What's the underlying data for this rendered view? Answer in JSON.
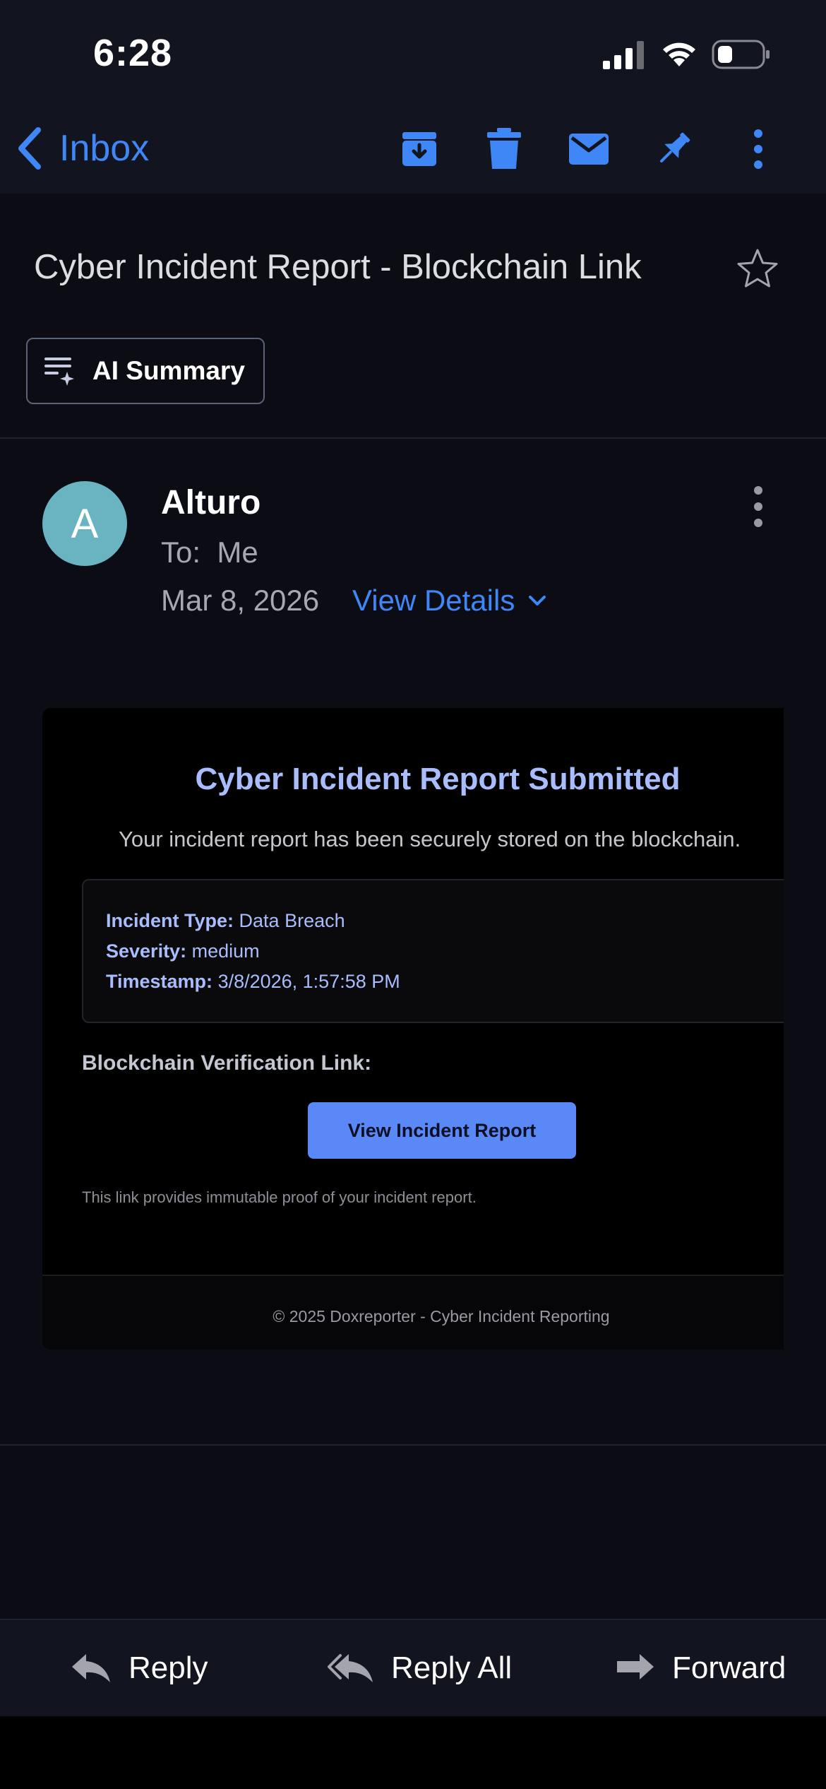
{
  "status_bar": {
    "time": "6:28"
  },
  "nav": {
    "back_label": "Inbox",
    "icons": [
      "archive-icon",
      "trash-icon",
      "mail-icon",
      "pin-icon",
      "more-vertical-icon"
    ]
  },
  "email": {
    "subject": "Cyber Incident Report - Blockchain Link",
    "ai_summary_label": "AI Summary",
    "sender": {
      "initial": "A",
      "name": "Alturo",
      "to_label": "To:",
      "to_value": "Me",
      "date": "Mar 8, 2026",
      "view_details_label": "View Details"
    },
    "body": {
      "title": "Cyber Incident Report Submitted",
      "subtitle": "Your incident report has been securely stored on the blockchain.",
      "incident_type_label": "Incident Type:",
      "incident_type_value": "Data Breach",
      "severity_label": "Severity:",
      "severity_value": "medium",
      "timestamp_label": "Timestamp:",
      "timestamp_value": "3/8/2026, 1:57:58 PM",
      "verification_label": "Blockchain Verification Link:",
      "cta_label": "View Incident Report",
      "note": "This link provides immutable proof of your incident report.",
      "footer": "© 2025 Doxreporter - Cyber Incident Reporting"
    }
  },
  "actions": {
    "reply": "Reply",
    "reply_all": "Reply All",
    "forward": "Forward"
  },
  "colors": {
    "background": "#0c0c14",
    "bar": "#12141f",
    "accent": "#3f86f6",
    "card_title": "#a9bcfb",
    "cta": "#5b88f7",
    "avatar": "#6ab4c2"
  }
}
